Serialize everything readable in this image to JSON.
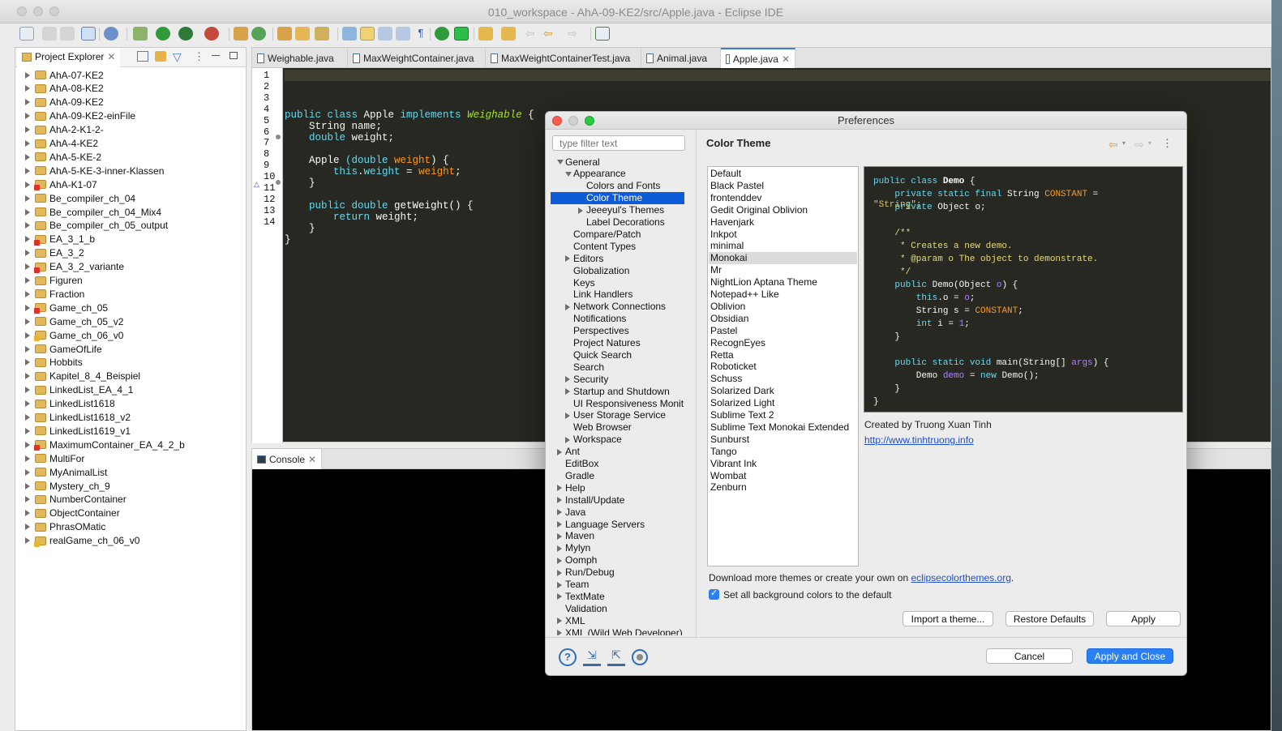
{
  "window": {
    "title": "010_workspace - AhA-09-KE2/src/Apple.java - Eclipse IDE"
  },
  "explorer": {
    "tab_label": "Project Explorer",
    "items": [
      {
        "label": "AhA-07-KE2",
        "marker": ""
      },
      {
        "label": "AhA-08-KE2",
        "marker": ""
      },
      {
        "label": "AhA-09-KE2",
        "marker": ""
      },
      {
        "label": "AhA-09-KE2-einFile",
        "marker": ""
      },
      {
        "label": "AhA-2-K1-2-",
        "marker": ""
      },
      {
        "label": "AhA-4-KE2",
        "marker": ""
      },
      {
        "label": "AhA-5-KE-2",
        "marker": ""
      },
      {
        "label": "AhA-5-KE-3-inner-Klassen",
        "marker": ""
      },
      {
        "label": "AhA-K1-07",
        "marker": "err"
      },
      {
        "label": "Be_compiler_ch_04",
        "marker": ""
      },
      {
        "label": "Be_compiler_ch_04_Mix4",
        "marker": ""
      },
      {
        "label": "Be_compiler_ch_05_output",
        "marker": ""
      },
      {
        "label": "EA_3_1_b",
        "marker": "err"
      },
      {
        "label": "EA_3_2",
        "marker": ""
      },
      {
        "label": "EA_3_2_variante",
        "marker": "err"
      },
      {
        "label": "Figuren",
        "marker": ""
      },
      {
        "label": "Fraction",
        "marker": ""
      },
      {
        "label": "Game_ch_05",
        "marker": "err"
      },
      {
        "label": "Game_ch_05_v2",
        "marker": ""
      },
      {
        "label": "Game_ch_06_v0",
        "marker": "warn"
      },
      {
        "label": "GameOfLife",
        "marker": ""
      },
      {
        "label": "Hobbits",
        "marker": ""
      },
      {
        "label": "Kapitel_8_4_Beispiel",
        "marker": ""
      },
      {
        "label": "LinkedList_EA_4_1",
        "marker": ""
      },
      {
        "label": "LinkedList1618",
        "marker": ""
      },
      {
        "label": "LinkedList1618_v2",
        "marker": ""
      },
      {
        "label": "LinkedList1619_v1",
        "marker": ""
      },
      {
        "label": "MaximumContainer_EA_4_2_b",
        "marker": "err"
      },
      {
        "label": "MultiFor",
        "marker": ""
      },
      {
        "label": "MyAnimalList",
        "marker": ""
      },
      {
        "label": "Mystery_ch_9",
        "marker": ""
      },
      {
        "label": "NumberContainer",
        "marker": ""
      },
      {
        "label": "ObjectContainer",
        "marker": ""
      },
      {
        "label": "PhrasOMatic",
        "marker": ""
      },
      {
        "label": "realGame_ch_06_v0",
        "marker": "warn"
      }
    ]
  },
  "editor": {
    "tabs": [
      {
        "label": "Weighable.java",
        "active": false
      },
      {
        "label": "MaxWeightContainer.java",
        "active": false
      },
      {
        "label": "MaxWeightContainerTest.java",
        "active": false
      },
      {
        "label": "Animal.java",
        "active": false
      },
      {
        "label": "Apple.java",
        "active": true
      }
    ],
    "line_numbers": [
      "1",
      "2",
      "3",
      "4",
      "5",
      "6",
      "7",
      "8",
      "9",
      "10",
      "11",
      "12",
      "13",
      "14"
    ],
    "code": {
      "l3": [
        "public class ",
        "Apple",
        " implements ",
        "Weighable",
        " {"
      ],
      "l4": [
        "    String ",
        "name",
        ";"
      ],
      "l5": [
        "    double ",
        "weight",
        ";"
      ],
      "l7": [
        "    Apple ",
        "(double ",
        "weight",
        ") {"
      ],
      "l8": [
        "        this",
        ".",
        "weight",
        " = ",
        "weight",
        ";"
      ],
      "l9": "    }",
      "l11": [
        "    public double ",
        "getWeight",
        "() {"
      ],
      "l12": [
        "        return ",
        "weight",
        ";"
      ],
      "l13": "    }",
      "l14": "}"
    }
  },
  "console": {
    "tab_label": "Console"
  },
  "preferences": {
    "title": "Preferences",
    "filter_placeholder": "type filter text",
    "tree": [
      {
        "label": "General",
        "level": 0,
        "arrow": "open"
      },
      {
        "label": "Appearance",
        "level": 1,
        "arrow": "open"
      },
      {
        "label": "Colors and Fonts",
        "level": 2,
        "arrow": ""
      },
      {
        "label": "Color Theme",
        "level": 2,
        "arrow": "",
        "selected": true
      },
      {
        "label": "Jeeeyul's Themes",
        "level": 2,
        "arrow": "closed"
      },
      {
        "label": "Label Decorations",
        "level": 2,
        "arrow": ""
      },
      {
        "label": "Compare/Patch",
        "level": 1,
        "arrow": ""
      },
      {
        "label": "Content Types",
        "level": 1,
        "arrow": ""
      },
      {
        "label": "Editors",
        "level": 1,
        "arrow": "closed"
      },
      {
        "label": "Globalization",
        "level": 1,
        "arrow": ""
      },
      {
        "label": "Keys",
        "level": 1,
        "arrow": ""
      },
      {
        "label": "Link Handlers",
        "level": 1,
        "arrow": ""
      },
      {
        "label": "Network Connections",
        "level": 1,
        "arrow": "closed"
      },
      {
        "label": "Notifications",
        "level": 1,
        "arrow": ""
      },
      {
        "label": "Perspectives",
        "level": 1,
        "arrow": ""
      },
      {
        "label": "Project Natures",
        "level": 1,
        "arrow": ""
      },
      {
        "label": "Quick Search",
        "level": 1,
        "arrow": ""
      },
      {
        "label": "Search",
        "level": 1,
        "arrow": ""
      },
      {
        "label": "Security",
        "level": 1,
        "arrow": "closed"
      },
      {
        "label": "Startup and Shutdown",
        "level": 1,
        "arrow": "closed"
      },
      {
        "label": "UI Responsiveness Monit",
        "level": 1,
        "arrow": ""
      },
      {
        "label": "User Storage Service",
        "level": 1,
        "arrow": "closed"
      },
      {
        "label": "Web Browser",
        "level": 1,
        "arrow": ""
      },
      {
        "label": "Workspace",
        "level": 1,
        "arrow": "closed"
      },
      {
        "label": "Ant",
        "level": 0,
        "arrow": "closed"
      },
      {
        "label": "EditBox",
        "level": 0,
        "arrow": ""
      },
      {
        "label": "Gradle",
        "level": 0,
        "arrow": ""
      },
      {
        "label": "Help",
        "level": 0,
        "arrow": "closed"
      },
      {
        "label": "Install/Update",
        "level": 0,
        "arrow": "closed"
      },
      {
        "label": "Java",
        "level": 0,
        "arrow": "closed"
      },
      {
        "label": "Language Servers",
        "level": 0,
        "arrow": "closed"
      },
      {
        "label": "Maven",
        "level": 0,
        "arrow": "closed"
      },
      {
        "label": "Mylyn",
        "level": 0,
        "arrow": "closed"
      },
      {
        "label": "Oomph",
        "level": 0,
        "arrow": "closed"
      },
      {
        "label": "Run/Debug",
        "level": 0,
        "arrow": "closed"
      },
      {
        "label": "Team",
        "level": 0,
        "arrow": "closed"
      },
      {
        "label": "TextMate",
        "level": 0,
        "arrow": "closed"
      },
      {
        "label": "Validation",
        "level": 0,
        "arrow": ""
      },
      {
        "label": "XML",
        "level": 0,
        "arrow": "closed"
      },
      {
        "label": "XML (Wild Web Developer)",
        "level": 0,
        "arrow": "closed"
      }
    ],
    "page_title": "Color Theme",
    "themes": [
      "Default",
      "Black Pastel",
      "frontenddev",
      "Gedit Original Oblivion",
      "Havenjark",
      "Inkpot",
      "minimal",
      "Monokai",
      "Mr",
      "NightLion Aptana Theme",
      "Notepad++ Like",
      "Oblivion",
      "Obsidian",
      "Pastel",
      "RecognEyes",
      "Retta",
      "Roboticket",
      "Schuss",
      "Solarized Dark",
      "Solarized Light",
      "Sublime Text 2",
      "Sublime Text Monokai Extended",
      "Sunburst",
      "Tango",
      "Vibrant Ink",
      "Wombat",
      "Zenburn"
    ],
    "selected_theme": "Monokai",
    "preview": {
      "p1": [
        "public class ",
        "Demo",
        " {"
      ],
      "p2": [
        "    private static final ",
        "String ",
        "CONSTANT",
        " ="
      ],
      "p3a": "\"String\";",
      "p3b": [
        "    private ",
        "Object ",
        "o",
        ";"
      ],
      "p5": "    /**",
      "p6": "     * Creates a new demo.",
      "p7": "     * @param o The object to demonstrate.",
      "p8": "     */",
      "p9": [
        "    public ",
        "Demo",
        "(Object ",
        "o",
        ") {"
      ],
      "p10": [
        "        this",
        ".o = ",
        "o",
        ";"
      ],
      "p11": [
        "        String ",
        "s",
        " = ",
        "CONSTANT",
        ";"
      ],
      "p12": [
        "        int ",
        "i",
        " = ",
        "1",
        ";"
      ],
      "p13": "    }",
      "p15": [
        "    public static void ",
        "main",
        "(String[] ",
        "args",
        ") {"
      ],
      "p16": [
        "        Demo ",
        "demo",
        " = ",
        "new ",
        "Demo",
        "();"
      ],
      "p17": "    }",
      "p18": "}"
    },
    "credit": "Created by Truong Xuan Tinh",
    "credit_link": "http://www.tinhtruong.info",
    "download_text": "Download more themes or create your own on ",
    "download_link": "eclipsecolorthemes.org",
    "download_suffix": ".",
    "checkbox_label": "Set all background colors to the default",
    "checkbox_checked": true,
    "buttons": {
      "import": "Import a theme...",
      "restore": "Restore Defaults",
      "apply": "Apply",
      "cancel": "Cancel",
      "apply_close": "Apply and Close"
    }
  }
}
